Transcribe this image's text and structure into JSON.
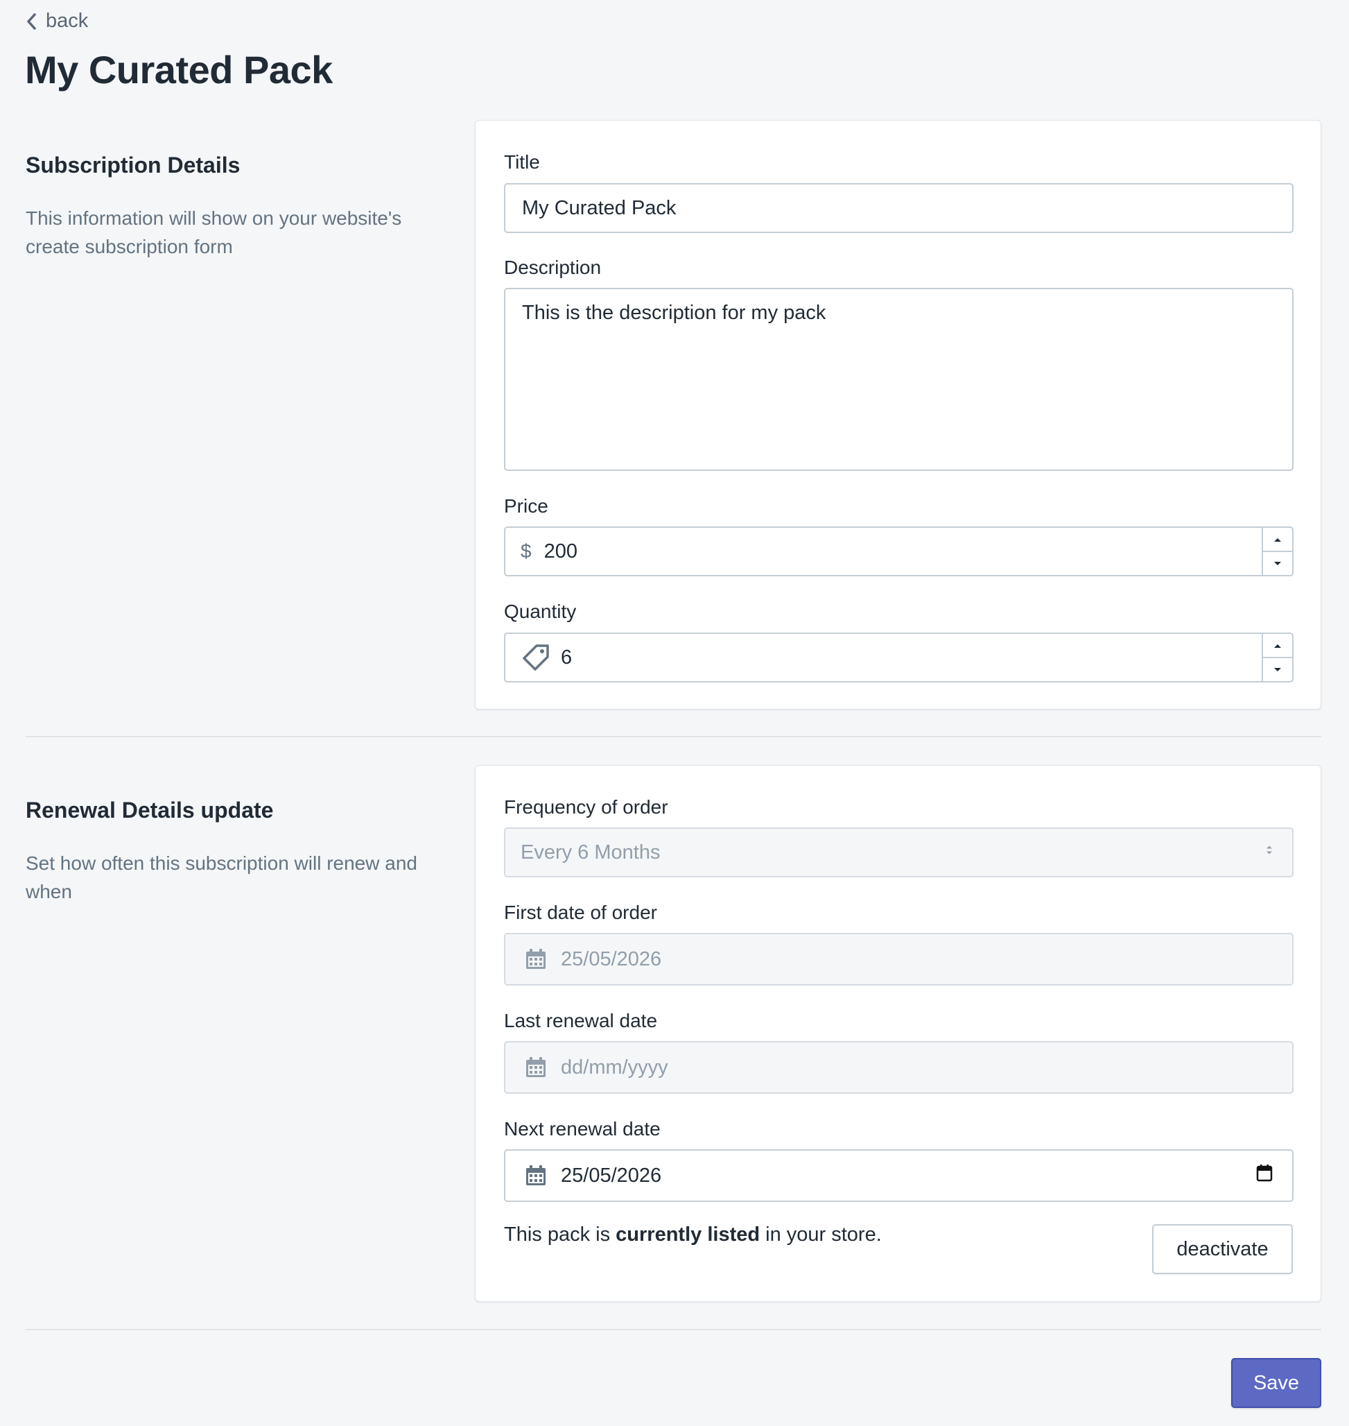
{
  "header": {
    "back_label": "back",
    "page_title": "My Curated Pack"
  },
  "subscription": {
    "heading": "Subscription Details",
    "description": "This information will show on your website's create subscription form",
    "title_label": "Title",
    "title_value": "My Curated Pack",
    "description_label": "Description",
    "description_value": "This is the description for my pack",
    "price_label": "Price",
    "price_prefix": "$",
    "price_value": "200",
    "quantity_label": "Quantity",
    "quantity_value": "6"
  },
  "renewal": {
    "heading": "Renewal Details update",
    "description": "Set how often this subscription will renew and when",
    "frequency_label": "Frequency of order",
    "frequency_value": "Every 6 Months",
    "first_date_label": "First date of order",
    "first_date_value": "25/05/2026",
    "last_renewal_label": "Last renewal date",
    "last_renewal_placeholder": "dd/mm/yyyy",
    "next_renewal_label": "Next renewal date",
    "next_renewal_value": "25/05/2026",
    "status_prefix": "This pack is ",
    "status_bold": "currently listed",
    "status_suffix": " in your store.",
    "deactivate_label": "deactivate"
  },
  "footer": {
    "save_label": "Save"
  },
  "colors": {
    "background": "#f5f6f8",
    "primary": "#5c6ac4",
    "text": "#212b36",
    "muted": "#637381"
  }
}
